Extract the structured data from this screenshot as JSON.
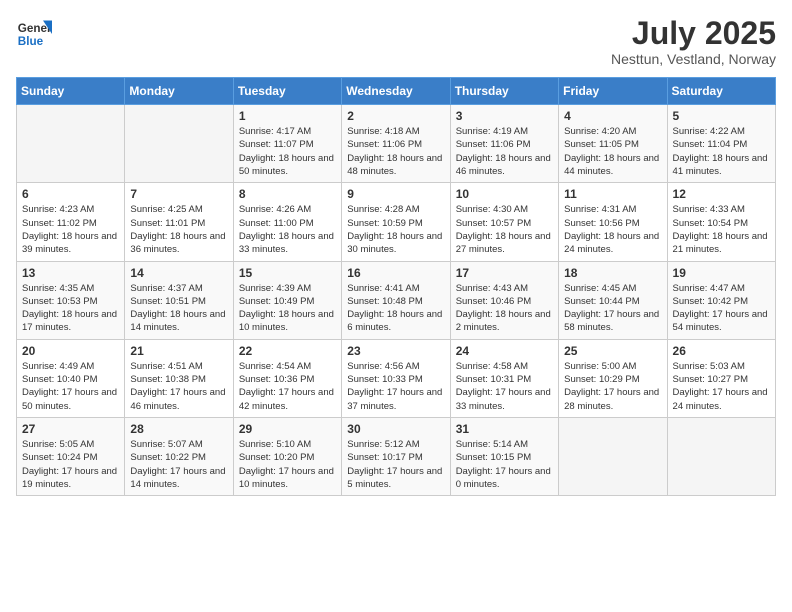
{
  "header": {
    "logo_general": "General",
    "logo_blue": "Blue",
    "month_title": "July 2025",
    "location": "Nesttun, Vestland, Norway"
  },
  "days_of_week": [
    "Sunday",
    "Monday",
    "Tuesday",
    "Wednesday",
    "Thursday",
    "Friday",
    "Saturday"
  ],
  "weeks": [
    [
      {
        "day": "",
        "info": ""
      },
      {
        "day": "",
        "info": ""
      },
      {
        "day": "1",
        "info": "Sunrise: 4:17 AM\nSunset: 11:07 PM\nDaylight: 18 hours and 50 minutes."
      },
      {
        "day": "2",
        "info": "Sunrise: 4:18 AM\nSunset: 11:06 PM\nDaylight: 18 hours and 48 minutes."
      },
      {
        "day": "3",
        "info": "Sunrise: 4:19 AM\nSunset: 11:06 PM\nDaylight: 18 hours and 46 minutes."
      },
      {
        "day": "4",
        "info": "Sunrise: 4:20 AM\nSunset: 11:05 PM\nDaylight: 18 hours and 44 minutes."
      },
      {
        "day": "5",
        "info": "Sunrise: 4:22 AM\nSunset: 11:04 PM\nDaylight: 18 hours and 41 minutes."
      }
    ],
    [
      {
        "day": "6",
        "info": "Sunrise: 4:23 AM\nSunset: 11:02 PM\nDaylight: 18 hours and 39 minutes."
      },
      {
        "day": "7",
        "info": "Sunrise: 4:25 AM\nSunset: 11:01 PM\nDaylight: 18 hours and 36 minutes."
      },
      {
        "day": "8",
        "info": "Sunrise: 4:26 AM\nSunset: 11:00 PM\nDaylight: 18 hours and 33 minutes."
      },
      {
        "day": "9",
        "info": "Sunrise: 4:28 AM\nSunset: 10:59 PM\nDaylight: 18 hours and 30 minutes."
      },
      {
        "day": "10",
        "info": "Sunrise: 4:30 AM\nSunset: 10:57 PM\nDaylight: 18 hours and 27 minutes."
      },
      {
        "day": "11",
        "info": "Sunrise: 4:31 AM\nSunset: 10:56 PM\nDaylight: 18 hours and 24 minutes."
      },
      {
        "day": "12",
        "info": "Sunrise: 4:33 AM\nSunset: 10:54 PM\nDaylight: 18 hours and 21 minutes."
      }
    ],
    [
      {
        "day": "13",
        "info": "Sunrise: 4:35 AM\nSunset: 10:53 PM\nDaylight: 18 hours and 17 minutes."
      },
      {
        "day": "14",
        "info": "Sunrise: 4:37 AM\nSunset: 10:51 PM\nDaylight: 18 hours and 14 minutes."
      },
      {
        "day": "15",
        "info": "Sunrise: 4:39 AM\nSunset: 10:49 PM\nDaylight: 18 hours and 10 minutes."
      },
      {
        "day": "16",
        "info": "Sunrise: 4:41 AM\nSunset: 10:48 PM\nDaylight: 18 hours and 6 minutes."
      },
      {
        "day": "17",
        "info": "Sunrise: 4:43 AM\nSunset: 10:46 PM\nDaylight: 18 hours and 2 minutes."
      },
      {
        "day": "18",
        "info": "Sunrise: 4:45 AM\nSunset: 10:44 PM\nDaylight: 17 hours and 58 minutes."
      },
      {
        "day": "19",
        "info": "Sunrise: 4:47 AM\nSunset: 10:42 PM\nDaylight: 17 hours and 54 minutes."
      }
    ],
    [
      {
        "day": "20",
        "info": "Sunrise: 4:49 AM\nSunset: 10:40 PM\nDaylight: 17 hours and 50 minutes."
      },
      {
        "day": "21",
        "info": "Sunrise: 4:51 AM\nSunset: 10:38 PM\nDaylight: 17 hours and 46 minutes."
      },
      {
        "day": "22",
        "info": "Sunrise: 4:54 AM\nSunset: 10:36 PM\nDaylight: 17 hours and 42 minutes."
      },
      {
        "day": "23",
        "info": "Sunrise: 4:56 AM\nSunset: 10:33 PM\nDaylight: 17 hours and 37 minutes."
      },
      {
        "day": "24",
        "info": "Sunrise: 4:58 AM\nSunset: 10:31 PM\nDaylight: 17 hours and 33 minutes."
      },
      {
        "day": "25",
        "info": "Sunrise: 5:00 AM\nSunset: 10:29 PM\nDaylight: 17 hours and 28 minutes."
      },
      {
        "day": "26",
        "info": "Sunrise: 5:03 AM\nSunset: 10:27 PM\nDaylight: 17 hours and 24 minutes."
      }
    ],
    [
      {
        "day": "27",
        "info": "Sunrise: 5:05 AM\nSunset: 10:24 PM\nDaylight: 17 hours and 19 minutes."
      },
      {
        "day": "28",
        "info": "Sunrise: 5:07 AM\nSunset: 10:22 PM\nDaylight: 17 hours and 14 minutes."
      },
      {
        "day": "29",
        "info": "Sunrise: 5:10 AM\nSunset: 10:20 PM\nDaylight: 17 hours and 10 minutes."
      },
      {
        "day": "30",
        "info": "Sunrise: 5:12 AM\nSunset: 10:17 PM\nDaylight: 17 hours and 5 minutes."
      },
      {
        "day": "31",
        "info": "Sunrise: 5:14 AM\nSunset: 10:15 PM\nDaylight: 17 hours and 0 minutes."
      },
      {
        "day": "",
        "info": ""
      },
      {
        "day": "",
        "info": ""
      }
    ]
  ]
}
